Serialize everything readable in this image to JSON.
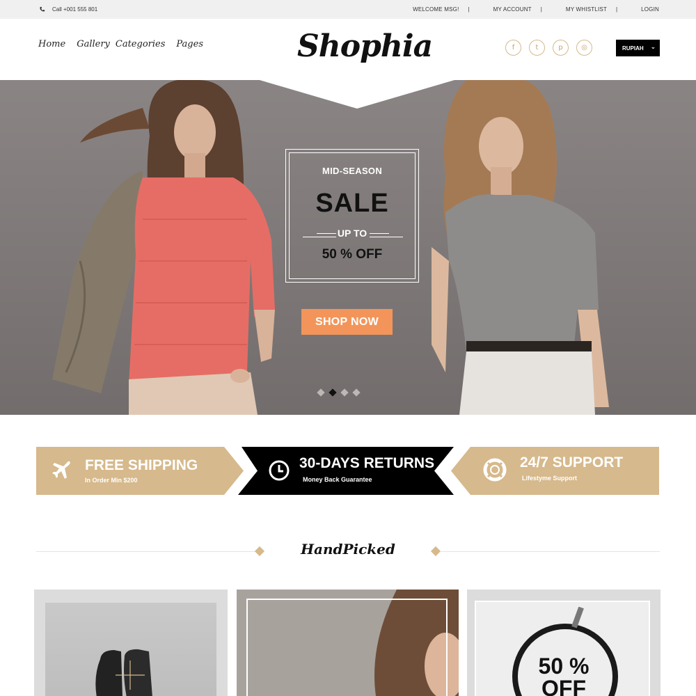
{
  "topbar": {
    "call": "Call +001 555 801",
    "links": [
      "WELCOME MSG!",
      "MY ACCOUNT",
      "MY WHISTLIST",
      "LOGIN"
    ],
    "separator": "|"
  },
  "nav": {
    "items": [
      "Home",
      "Gallery",
      "Categories",
      "Pages"
    ]
  },
  "logo": "Shophia",
  "socials": [
    {
      "icon": "facebook-icon",
      "glyph": "f"
    },
    {
      "icon": "twitter-icon",
      "glyph": "t"
    },
    {
      "icon": "pinterest-icon",
      "glyph": "p"
    },
    {
      "icon": "instagram-icon",
      "glyph": "◎"
    }
  ],
  "currency": {
    "label": "RUPIAH",
    "caret": "⌄"
  },
  "hero": {
    "kicker": "MID-SEASON",
    "headline": "SALE",
    "upto": "UP TO",
    "discount": "50 %  OFF",
    "cta": "SHOP NOW",
    "slides_count": 4,
    "active_slide": 2
  },
  "features": [
    {
      "icon": "airplane-icon",
      "title": "FREE SHIPPING",
      "subtitle": "In Order Min $200"
    },
    {
      "icon": "clock-icon",
      "title": "30-DAYS RETURNS",
      "subtitle": "Money Back  Guarantee"
    },
    {
      "icon": "lifebuoy-icon",
      "title": "24/7 SUPPORT",
      "subtitle": "Lifestyme Support"
    }
  ],
  "handpicked": {
    "title": "HandPicked",
    "card3_text": "50 %",
    "card3_text2": "OFF"
  },
  "colors": {
    "gold": "#d6b98c",
    "black": "#000000",
    "orange": "#f3955a",
    "hero_bg": "#807b7a"
  }
}
